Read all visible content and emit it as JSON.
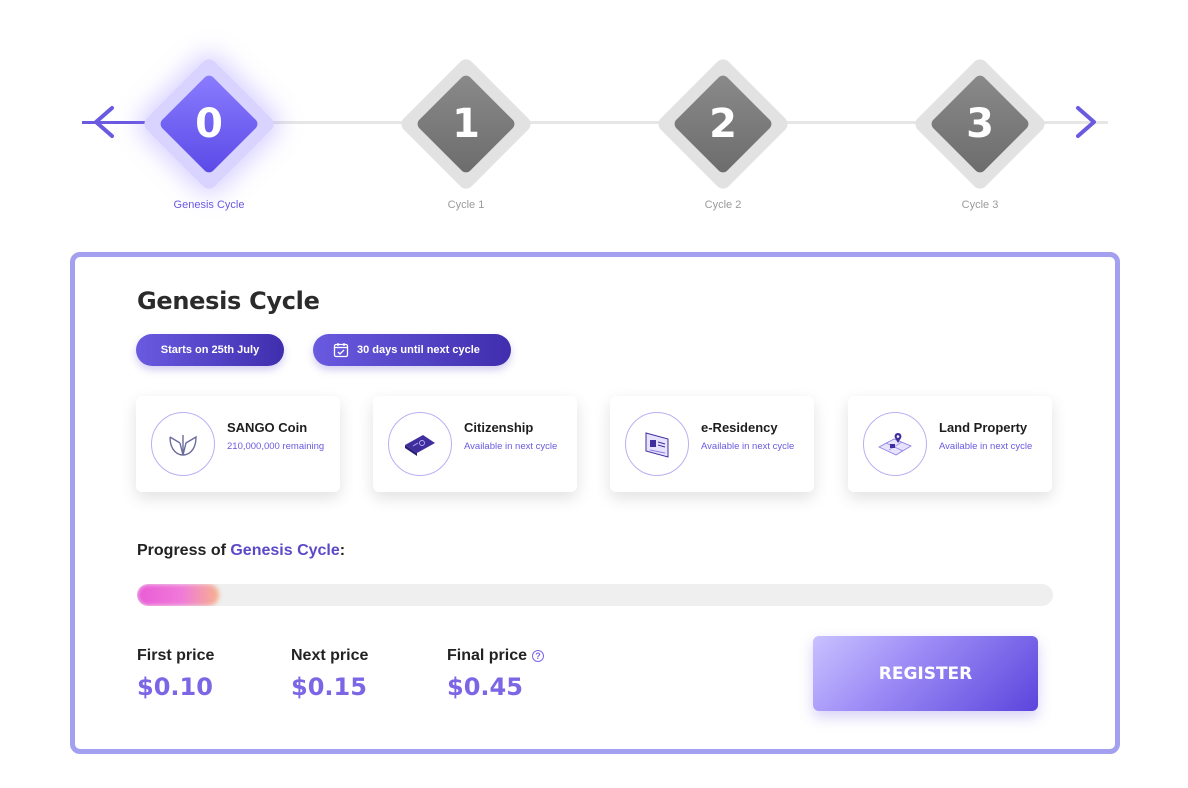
{
  "stepper": {
    "steps": [
      {
        "number": "0",
        "label": "Genesis Cycle",
        "active": true
      },
      {
        "number": "1",
        "label": "Cycle 1",
        "active": false
      },
      {
        "number": "2",
        "label": "Cycle 2",
        "active": false
      },
      {
        "number": "3",
        "label": "Cycle 3",
        "active": false
      }
    ],
    "prev_icon": "chevron-left-icon",
    "next_icon": "chevron-right-icon"
  },
  "card": {
    "title": "Genesis Cycle",
    "start_pill": "Starts on 25th July",
    "days_pill": "30 days until next cycle",
    "days_icon": "calendar-icon",
    "features": [
      {
        "title": "SANGO Coin",
        "subtitle": "210,000,000 remaining",
        "icon": "sango-coin-icon"
      },
      {
        "title": "Citizenship",
        "subtitle": "Available in next cycle",
        "icon": "passport-icon"
      },
      {
        "title": "e-Residency",
        "subtitle": "Available in next cycle",
        "icon": "id-card-icon"
      },
      {
        "title": "Land Property",
        "subtitle": "Available in next cycle",
        "icon": "land-map-icon"
      }
    ],
    "progress": {
      "label_prefix": "Progress of ",
      "label_accent": "Genesis Cycle",
      "label_suffix": ":",
      "fraction": 0.09
    },
    "prices": [
      {
        "label": "First price",
        "value": "$0.10",
        "help": false
      },
      {
        "label": "Next price",
        "value": "$0.15",
        "help": false
      },
      {
        "label": "Final price",
        "value": "$0.45",
        "help": true
      }
    ],
    "register_label": "REGISTER"
  },
  "colors": {
    "accent": "#6a5ae0",
    "price": "#7c66e6",
    "card_border": "#a2a0ef",
    "inactive_step": "#7a7a7a"
  }
}
